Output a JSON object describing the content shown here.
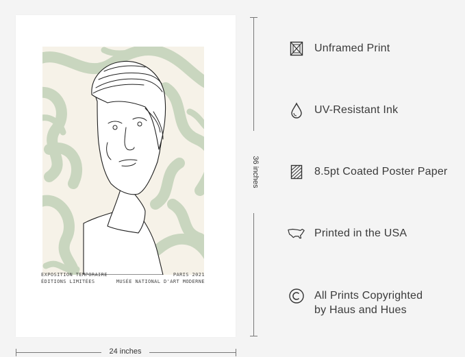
{
  "poster": {
    "caption_left": [
      "EXPOSITION TEMPORAIRE",
      "ÉDITIONS LIMITÉES"
    ],
    "caption_right": [
      "PARIS 2021",
      "MUSÉE NATIONAL D'ART MODERNE"
    ],
    "colors": {
      "swirl": "#c9d6bf",
      "background": "#f6f2e8",
      "line": "#1e1e1e"
    }
  },
  "dimensions": {
    "height_label": "36 inches",
    "width_label": "24 inches"
  },
  "features": [
    {
      "icon": "unframed-print-icon",
      "label": "Unframed Print"
    },
    {
      "icon": "ink-drop-icon",
      "label": "UV-Resistant Ink"
    },
    {
      "icon": "paper-hatch-icon",
      "label": "8.5pt Coated Poster Paper"
    },
    {
      "icon": "usa-map-icon",
      "label": "Printed in the USA"
    },
    {
      "icon": "copyright-icon",
      "label": "All Prints Copyrighted",
      "label2": "by Haus and Hues"
    }
  ]
}
